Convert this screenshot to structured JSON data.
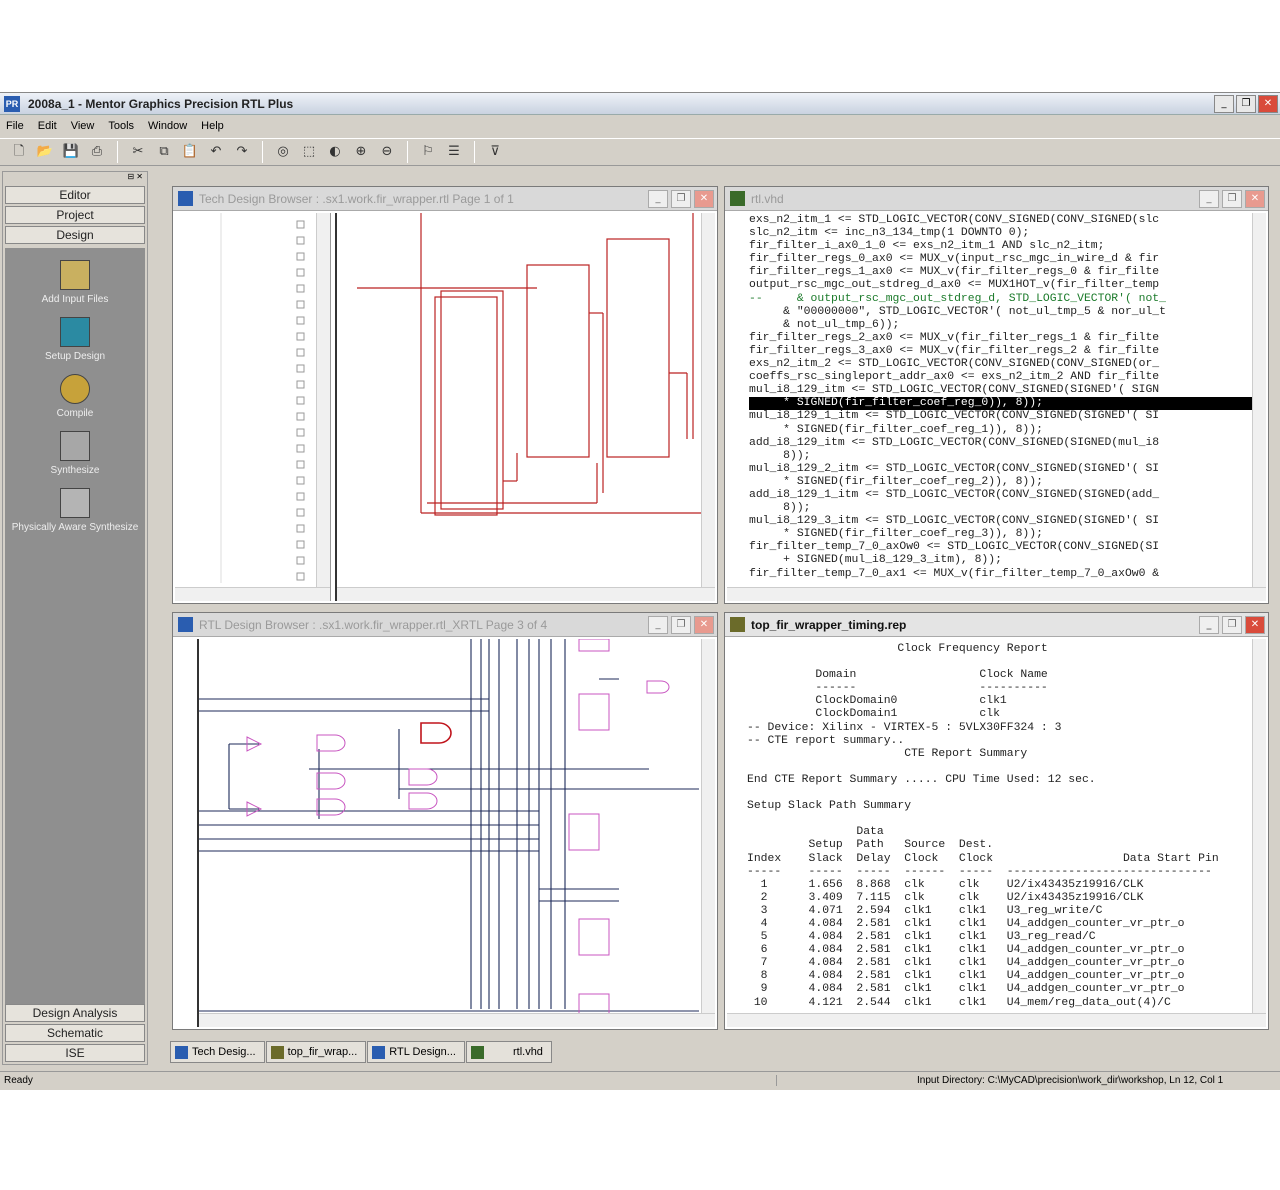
{
  "window": {
    "title": "2008a_1 - Mentor Graphics Precision RTL Plus",
    "controls": [
      "_",
      "❐",
      "✕"
    ]
  },
  "menu": [
    "File",
    "Edit",
    "View",
    "Tools",
    "Window",
    "Help"
  ],
  "left_panel": {
    "top_buttons": [
      "Editor",
      "Project",
      "Design"
    ],
    "tools": [
      {
        "label": "Add Input Files",
        "icon": "add-input-files-icon"
      },
      {
        "label": "Setup Design",
        "icon": "setup-design-icon"
      },
      {
        "label": "Compile",
        "icon": "compile-gears-icon"
      },
      {
        "label": "Synthesize",
        "icon": "synthesize-icon"
      },
      {
        "label": "Physically Aware Synthesize",
        "icon": "physical-synthesize-icon"
      }
    ],
    "bottom_buttons": [
      "Design Analysis",
      "Schematic",
      "ISE"
    ]
  },
  "windows": {
    "tech": {
      "title": "Tech Design Browser : .sx1.work.fir_wrapper.rtl Page 1 of 1"
    },
    "rtlvhd": {
      "title": "rtl.vhd"
    },
    "rtlbrowser": {
      "title": "RTL Design Browser : .sx1.work.fir_wrapper.rtl_XRTL Page 3 of 4"
    },
    "timing": {
      "title": "top_fir_wrapper_timing.rep"
    }
  },
  "code_lines": [
    "exs_n2_itm_1 <= STD_LOGIC_VECTOR(CONV_SIGNED(CONV_SIGNED(slc",
    "slc_n2_itm <= inc_n3_134_tmp(1 DOWNTO 0);",
    "fir_filter_i_ax0_1_0 <= exs_n2_itm_1 AND slc_n2_itm;",
    "fir_filter_regs_0_ax0 <= MUX_v(input_rsc_mgc_in_wire_d & fir",
    "fir_filter_regs_1_ax0 <= MUX_v(fir_filter_regs_0 & fir_filte",
    "output_rsc_mgc_out_stdreg_d_ax0 <= MUX1HOT_v(fir_filter_temp",
    "--     & output_rsc_mgc_out_stdreg_d, STD_LOGIC_VECTOR'( not_",
    "     & \"00000000\", STD_LOGIC_VECTOR'( not_ul_tmp_5 & nor_ul_t",
    "     & not_ul_tmp_6));",
    "fir_filter_regs_2_ax0 <= MUX_v(fir_filter_regs_1 & fir_filte",
    "fir_filter_regs_3_ax0 <= MUX_v(fir_filter_regs_2 & fir_filte",
    "exs_n2_itm_2 <= STD_LOGIC_VECTOR(CONV_SIGNED(CONV_SIGNED(or_",
    "coeffs_rsc_singleport_addr_ax0 <= exs_n2_itm_2 AND fir_filte",
    "mul_i8_129_itm <= STD_LOGIC_VECTOR(CONV_SIGNED(SIGNED'( SIGN",
    "     * SIGNED(fir_filter_coef_reg_0)), 8));",
    "mul_i8_129_1_itm <= STD_LOGIC_VECTOR(CONV_SIGNED(SIGNED'( SI",
    "     * SIGNED(fir_filter_coef_reg_1)), 8));",
    "add_i8_129_itm <= STD_LOGIC_VECTOR(CONV_SIGNED(SIGNED(mul_i8",
    "     8));",
    "mul_i8_129_2_itm <= STD_LOGIC_VECTOR(CONV_SIGNED(SIGNED'( SI",
    "     * SIGNED(fir_filter_coef_reg_2)), 8));",
    "add_i8_129_1_itm <= STD_LOGIC_VECTOR(CONV_SIGNED(SIGNED(add_",
    "     8));",
    "mul_i8_129_3_itm <= STD_LOGIC_VECTOR(CONV_SIGNED(SIGNED'( SI",
    "     * SIGNED(fir_filter_coef_reg_3)), 8));",
    "fir_filter_temp_7_0_axOw0 <= STD_LOGIC_VECTOR(CONV_SIGNED(SI",
    "     + SIGNED(mul_i8_129_3_itm), 8));",
    "fir_filter_temp_7_0_ax1 <= MUX_v(fir_filter_temp_7_0_axOw0 &"
  ],
  "report_lines": [
    "                      Clock Frequency Report",
    "",
    "          Domain                  Clock Name",
    "          ------                  ----------",
    "          ClockDomain0            clk1",
    "          ClockDomain1            clk",
    "-- Device: Xilinx - VIRTEX-5 : 5VLX30FF324 : 3",
    "-- CTE report summary..",
    "                       CTE Report Summary",
    "",
    "End CTE Report Summary ..... CPU Time Used: 12 sec.",
    "",
    "Setup Slack Path Summary",
    "",
    "                Data",
    "         Setup  Path   Source  Dest.",
    "Index    Slack  Delay  Clock   Clock                   Data Start Pin",
    "-----    -----  -----  ------  -----  ------------------------------",
    "  1      1.656  8.868  clk     clk    U2/ix43435z19916/CLK",
    "  2      3.409  7.115  clk     clk    U2/ix43435z19916/CLK",
    "  3      4.071  2.594  clk1    clk1   U3_reg_write/C",
    "  4      4.084  2.581  clk1    clk1   U4_addgen_counter_vr_ptr_o",
    "  5      4.084  2.581  clk1    clk1   U3_reg_read/C",
    "  6      4.084  2.581  clk1    clk1   U4_addgen_counter_vr_ptr_o",
    "  7      4.084  2.581  clk1    clk1   U4_addgen_counter_vr_ptr_o",
    "  8      4.084  2.581  clk1    clk1   U4_addgen_counter_vr_ptr_o",
    "  9      4.084  2.581  clk1    clk1   U4_addgen_counter_vr_ptr_o",
    " 10      4.121  2.544  clk1    clk1   U4_mem/reg_data_out(4)/C"
  ],
  "tabs": [
    "Tech Desig...",
    "top_fir_wrap...",
    "RTL Design...",
    "rtl.vhd"
  ],
  "status": {
    "left": "Ready",
    "right": "Input Directory: C:\\MyCAD\\precision\\work_dir\\workshop, Ln 12, Col 1"
  }
}
